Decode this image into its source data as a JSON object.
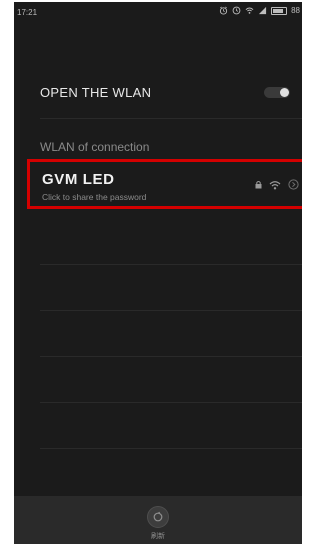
{
  "status_bar": {
    "time": "17:21",
    "battery_percent": "88",
    "icons": [
      "alarm-icon",
      "clock-icon",
      "wifi-icon",
      "signal-icon",
      "battery-icon"
    ]
  },
  "wlan": {
    "toggle_label": "OPEN  THE  WLAN",
    "enabled": true
  },
  "connection_section": {
    "label": "WLAN of connection"
  },
  "network": {
    "name": "GVM  LED",
    "subtitle": "Click to share the password",
    "icons": [
      "lock-icon",
      "wifi-icon",
      "chevron-right-circle-icon"
    ],
    "highlight_color": "#d40000"
  },
  "bottom_bar": {
    "refresh_label": "刷新"
  }
}
